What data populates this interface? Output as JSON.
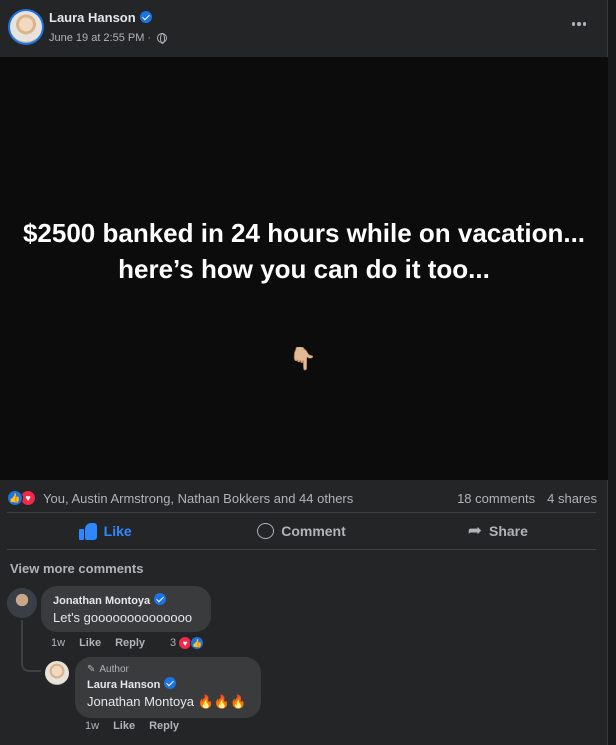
{
  "post": {
    "author": "Laura Hanson",
    "timestamp": "June 19 at 2:55 PM",
    "separator": "·",
    "privacy_icon": "globe-icon",
    "media_text": "$2500 banked in 24 hours while on vacation... here’s how you can do it too...",
    "media_emoji": "👇🏼"
  },
  "summary": {
    "reactors": "You, Austin Armstrong, Nathan Bokkers and 44 others",
    "comments_count": "18 comments",
    "shares_count": "4 shares"
  },
  "actions": {
    "like_label": "Like",
    "comment_label": "Comment",
    "share_label": "Share"
  },
  "comments": {
    "view_more": "View more comments",
    "items": [
      {
        "name": "Jonathan Montoya",
        "text": "Let's goooooooooooooo",
        "age": "1w",
        "like": "Like",
        "reply": "Reply",
        "reaction_count": "3"
      },
      {
        "badge": "Author",
        "name": "Laura Hanson",
        "text": "Jonathan Montoya 🔥🔥🔥",
        "age": "1w",
        "like": "Like",
        "reply": "Reply"
      }
    ]
  },
  "colors": {
    "accent": "#2d88ff",
    "verified": "#1b74e4",
    "love": "#f02849",
    "surface": "#242526",
    "bubble": "#3a3b3c"
  }
}
